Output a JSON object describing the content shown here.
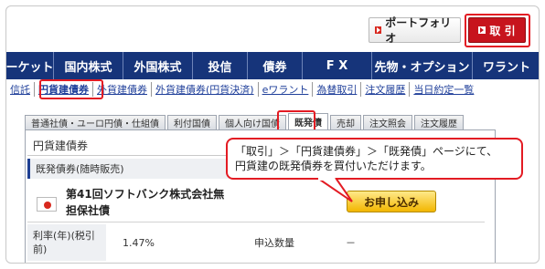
{
  "top_buttons": {
    "portfolio": "ポートフォリオ",
    "trade": "取 引"
  },
  "nav": {
    "items": [
      "ーケット",
      "国内株式",
      "外国株式",
      "投信",
      "債券",
      "F X",
      "先物・オプション",
      "ワラント"
    ]
  },
  "sublinks": {
    "items": [
      "信託",
      "円貨建債券",
      "外貨建債券",
      "外貨建債券(円貨決済)",
      "eワラント",
      "為替取引",
      "注文履歴",
      "当日約定一覧"
    ]
  },
  "tabs": {
    "items": [
      "普通社債・ユーロ円債・仕組債",
      "利付国債",
      "個人向け国債",
      "既発債",
      "売却",
      "注文照会",
      "注文履歴"
    ]
  },
  "panel": {
    "title": "円貨建債券",
    "subhead": "既発債券(随時販売)",
    "bond_name_line1": "第41回ソフトバンク株式会社無",
    "bond_name_line2": "担保社債",
    "apply_label": "お申し込み",
    "rate_label": "利率(年)(税引前)",
    "rate_value": "1.47%",
    "quantity_label": "申込数量",
    "quantity_value": "－"
  },
  "callout": {
    "line1": "「取引」＞「円貨建債券」＞「既発債」ページにて、",
    "line2": "円貨建の既発債券を買付いただけます。"
  },
  "colors": {
    "nav_bg": "#16347a",
    "highlight_red": "#e31b23",
    "apply_yellow": "#f2b600"
  }
}
